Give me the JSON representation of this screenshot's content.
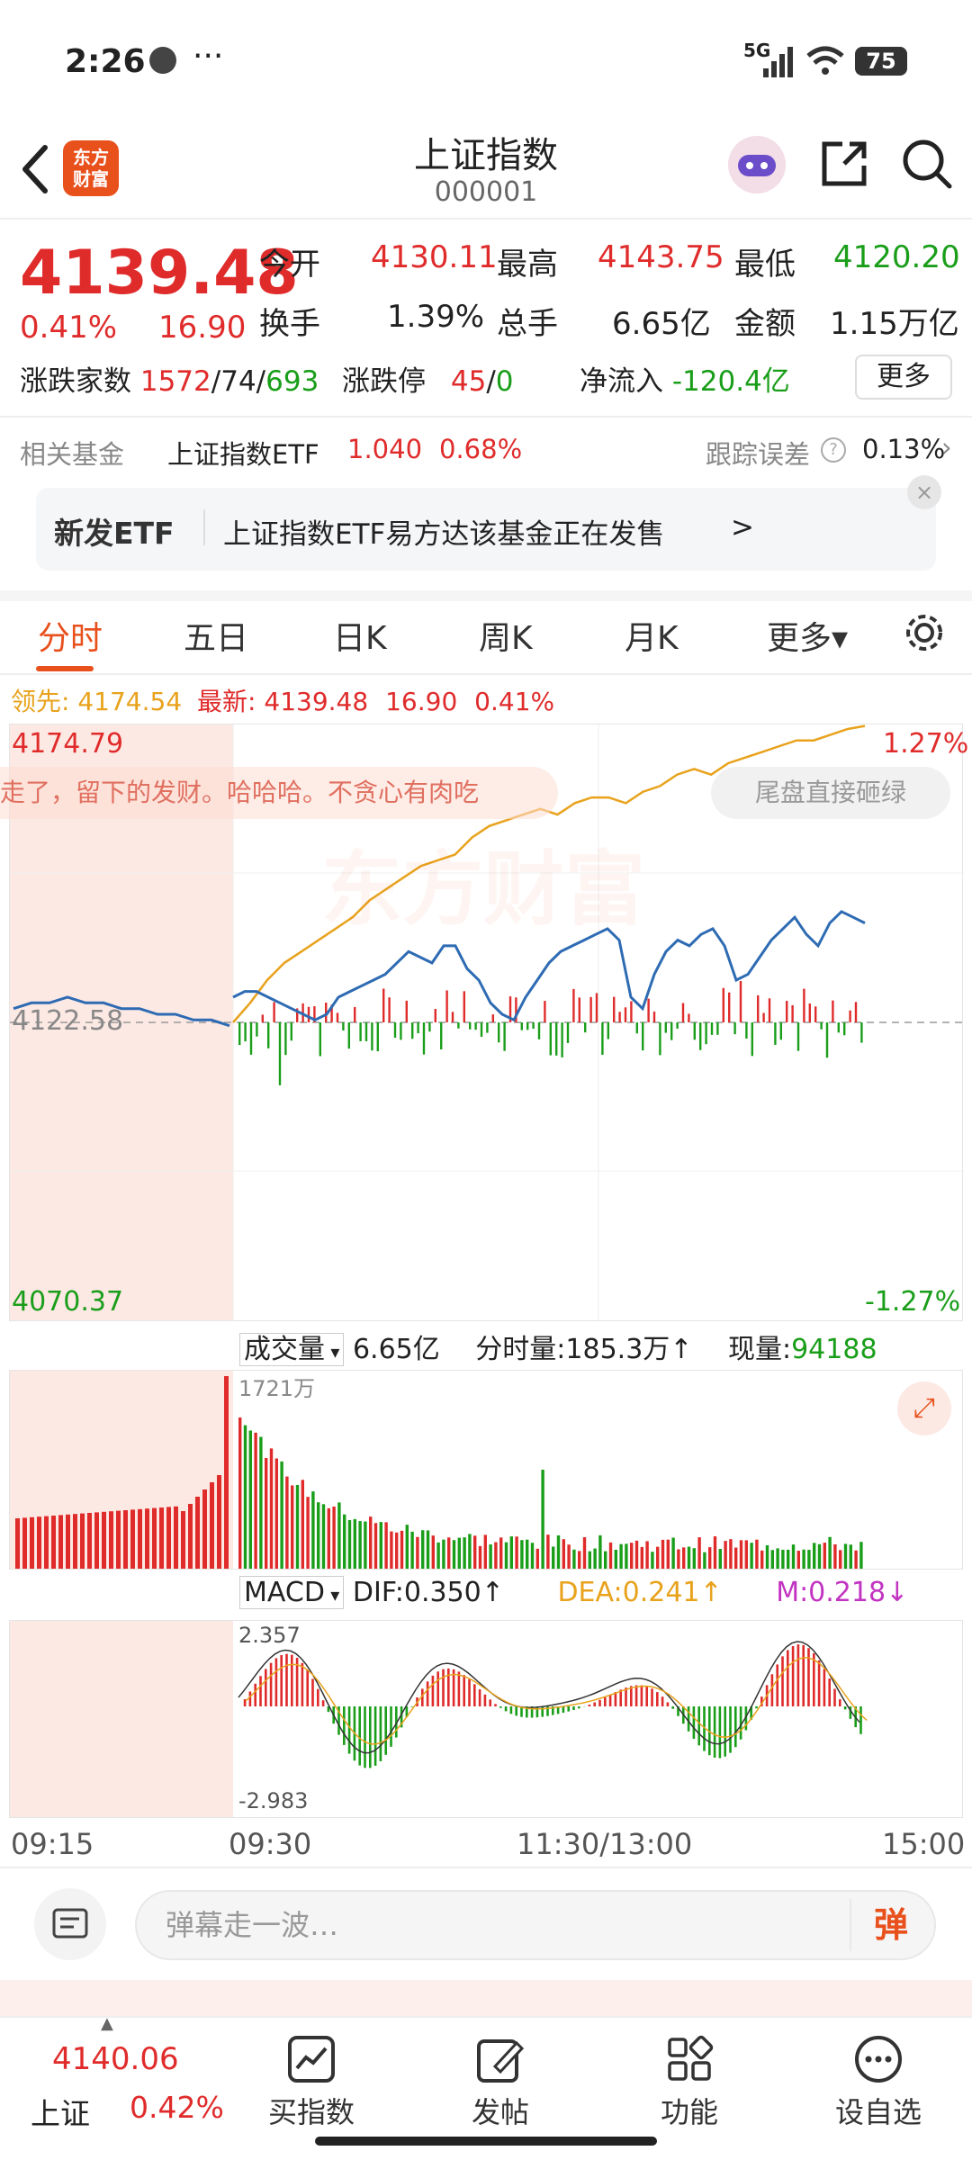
{
  "status": {
    "time": "2:26",
    "dots": "···",
    "network": "5G",
    "battery": "75"
  },
  "header": {
    "title": "上证指数",
    "code": "000001",
    "logo_text": "东方财富"
  },
  "quote": {
    "price": "4139.48",
    "change_pct": "0.41%",
    "change": "16.90",
    "open_label": "今开",
    "open": "4130.11",
    "high_label": "最高",
    "high": "4143.75",
    "low_label": "最低",
    "low": "4120.20",
    "turnover_label": "换手",
    "turnover": "1.39%",
    "volume_label": "总手",
    "volume": "6.65亿",
    "amount_label": "金额",
    "amount": "1.15万亿",
    "breadth_label": "涨跌家数",
    "breadth_up": "1572",
    "breadth_flat": "74",
    "breadth_down": "693",
    "limit_label": "涨跌停",
    "limit_up": "45",
    "limit_down": "0",
    "netflow_label": "净流入",
    "netflow": "-120.4亿",
    "more_button": "更多"
  },
  "fund": {
    "label": "相关基金",
    "name": "上证指数ETF",
    "price": "1.040",
    "pct": "0.68%",
    "tracking_label": "跟踪误差",
    "tracking": "0.13%"
  },
  "etf_banner": {
    "tag": "新发ETF",
    "text": "上证指数ETF易方达该基金正在发售",
    "arrow": ">"
  },
  "tabs": [
    {
      "label": "分时"
    },
    {
      "label": "五日"
    },
    {
      "label": "日K"
    },
    {
      "label": "周K"
    },
    {
      "label": "月K"
    },
    {
      "label": "更多▾"
    }
  ],
  "lead_row": {
    "lead_label": "领先:",
    "lead": "4174.54",
    "latest_label": "最新:",
    "latest": "4139.48",
    "chg": "16.90",
    "pct": "0.41%"
  },
  "chart_labels": {
    "top": "4174.79",
    "top_pct": "1.27%",
    "mid": "4122.58",
    "bottom": "4070.37",
    "bottom_pct": "-1.27%",
    "watermark": "东方财富"
  },
  "danmu": {
    "left": "走了，留下的发财。哈哈哈。不贪心有肉吃",
    "right": "尾盘直接砸绿"
  },
  "volume": {
    "label": "成交量",
    "total": "6.65亿",
    "fenshi": "分时量:185.3万↑",
    "now_label": "现量:",
    "now": "94188",
    "max": "1721万"
  },
  "macd": {
    "label": "MACD",
    "dif": "DIF:0.350↑",
    "dea": "DEA:0.241↑",
    "m": "M:0.218↓",
    "max": "2.357",
    "min": "-2.983"
  },
  "time_axis": [
    "09:15",
    "09:30",
    "11:30/13:00",
    "15:00"
  ],
  "comment": {
    "placeholder": "弹幕走一波…",
    "danmu_btn": "弹"
  },
  "bottom": {
    "index_price": "4140.06",
    "index_name": "上证",
    "index_pct": "0.42%",
    "items": [
      {
        "label": "买指数"
      },
      {
        "label": "发帖"
      },
      {
        "label": "功能"
      },
      {
        "label": "设自选"
      }
    ]
  },
  "colors": {
    "up": "#e02b2b",
    "down": "#1a9e1a",
    "accent": "#e8501c",
    "index_line": "#2e6bb3",
    "lead_line": "#e8a21c"
  },
  "chart_data": {
    "type": "line",
    "series": [
      {
        "values": [
          4127,
          4128,
          4128,
          4127,
          4126,
          4125,
          4124,
          4123,
          4124,
          4127,
          4128,
          4129,
          4130,
          4131,
          4133,
          4135,
          4134,
          4133,
          4136,
          4136,
          4132,
          4130,
          4126,
          4124,
          4123,
          4127,
          4130,
          4133,
          4135,
          4136,
          4137,
          4138,
          4139,
          4137,
          4127,
          4125,
          4131,
          4135,
          4137,
          4136,
          4138,
          4139,
          4136,
          4130,
          4131,
          4134,
          4137,
          4139,
          4141,
          4138,
          4136,
          4140,
          4142,
          4141,
          4140
        ]
      },
      {
        "values": [
          4122.58,
          4126,
          4130,
          4133,
          4135,
          4137,
          4139,
          4141,
          4144,
          4146,
          4148,
          4150,
          4151,
          4152,
          4155,
          4157,
          4158,
          4159,
          4160,
          4159,
          4161,
          4162,
          4162,
          4161,
          4163,
          4164,
          4166,
          4167,
          4166,
          4168,
          4169,
          4170,
          4171,
          4172,
          4172,
          4173,
          4174,
          4174.54
        ]
      }
    ],
    "ylim": [
      4070.37,
      4174.79
    ],
    "baseline": 4122.58
  }
}
